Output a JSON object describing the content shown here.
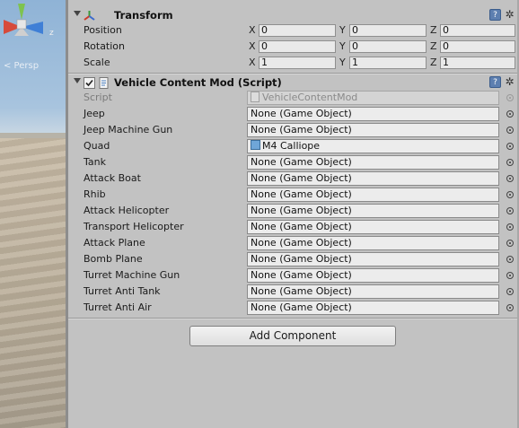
{
  "scene": {
    "persp_label": "< Persp",
    "axis_label": "z"
  },
  "transform": {
    "title": "Transform",
    "rows": [
      {
        "label": "Position",
        "x": "0",
        "y": "0",
        "z": "0"
      },
      {
        "label": "Rotation",
        "x": "0",
        "y": "0",
        "z": "0"
      },
      {
        "label": "Scale",
        "x": "1",
        "y": "1",
        "z": "1"
      }
    ],
    "axis": {
      "x": "X",
      "y": "Y",
      "z": "Z"
    }
  },
  "vehicle_mod": {
    "title": "Vehicle Content Mod (Script)",
    "script_label": "Script",
    "script_value": "VehicleContentMod",
    "fields": [
      {
        "label": "Jeep",
        "value": "None (Game Object)"
      },
      {
        "label": "Jeep Machine Gun",
        "value": "None (Game Object)"
      },
      {
        "label": "Quad",
        "value": "M4 Calliope"
      },
      {
        "label": "Tank",
        "value": "None (Game Object)"
      },
      {
        "label": "Attack Boat",
        "value": "None (Game Object)"
      },
      {
        "label": "Rhib",
        "value": "None (Game Object)"
      },
      {
        "label": "Attack Helicopter",
        "value": "None (Game Object)"
      },
      {
        "label": "Transport Helicopter",
        "value": "None (Game Object)"
      },
      {
        "label": "Attack Plane",
        "value": "None (Game Object)"
      },
      {
        "label": "Bomb Plane",
        "value": "None (Game Object)"
      },
      {
        "label": "Turret Machine Gun",
        "value": "None (Game Object)"
      },
      {
        "label": "Turret Anti Tank",
        "value": "None (Game Object)"
      },
      {
        "label": "Turret Anti Air",
        "value": "None (Game Object)"
      }
    ]
  },
  "add_component_label": "Add Component",
  "icons": {
    "help": "?",
    "gear": "✲"
  }
}
